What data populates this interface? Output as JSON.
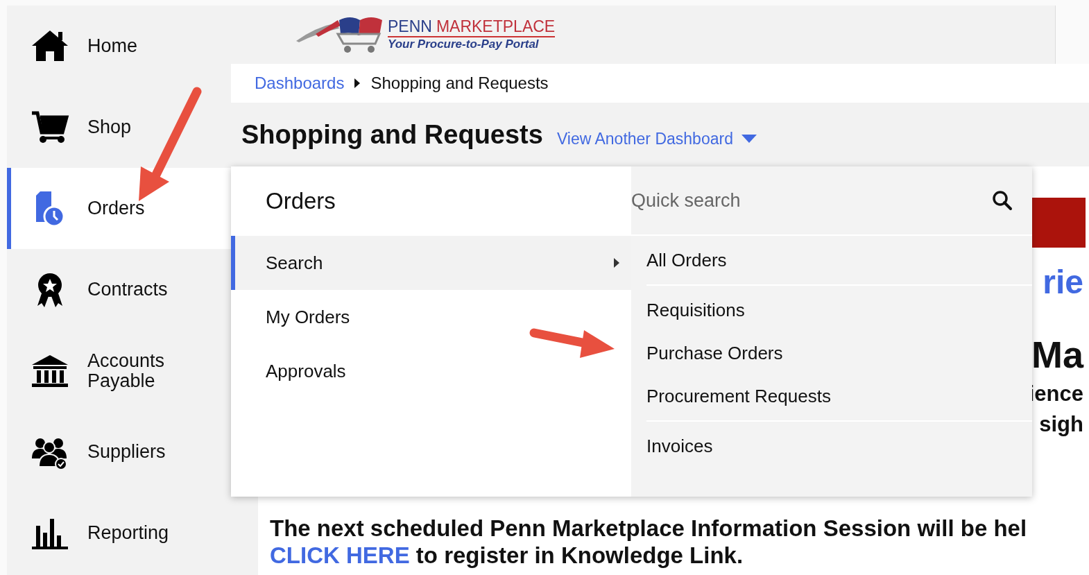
{
  "sidebar": {
    "items": [
      {
        "label": "Home",
        "selected": false
      },
      {
        "label": "Shop",
        "selected": false
      },
      {
        "label": "Orders",
        "selected": true
      },
      {
        "label": "Contracts",
        "selected": false
      },
      {
        "label": "Accounts Payable",
        "selected": false
      },
      {
        "label": "Suppliers",
        "selected": false
      },
      {
        "label": "Reporting",
        "selected": false
      }
    ]
  },
  "header": {
    "logo": {
      "title": [
        "PENN",
        "MARKETPLACE"
      ],
      "subtitle": "Your Procure-to-Pay Portal"
    }
  },
  "breadcrumb": [
    {
      "label": "Dashboards",
      "kind": "link"
    },
    {
      "label": "Shopping and Requests",
      "kind": "current"
    }
  ],
  "page_title": "Shopping and Requests",
  "dashboard_switch": "View Another Dashboard",
  "orders_menu": {
    "title": "Orders",
    "items": [
      {
        "label": "Search",
        "selected": true,
        "has_submenu": true
      },
      {
        "label": "My Orders",
        "selected": false,
        "has_submenu": false
      },
      {
        "label": "Approvals",
        "selected": false,
        "has_submenu": false
      }
    ]
  },
  "submenu": {
    "search": {
      "placeholder": "Quick search"
    },
    "groups": [
      {
        "items": [
          "All Orders"
        ]
      },
      {
        "items": [
          "Requisitions",
          "Purchase Orders",
          "Procurement Requests"
        ]
      },
      {
        "items": [
          "Invoices"
        ]
      }
    ]
  },
  "background_fragments": [
    "rie",
    "Ma",
    "ience",
    "sigh"
  ],
  "announcement": {
    "text": "The next scheduled Penn Marketplace Information Session will be hel",
    "link": "CLICK HERE",
    "after": "to register in Knowledge Link."
  }
}
